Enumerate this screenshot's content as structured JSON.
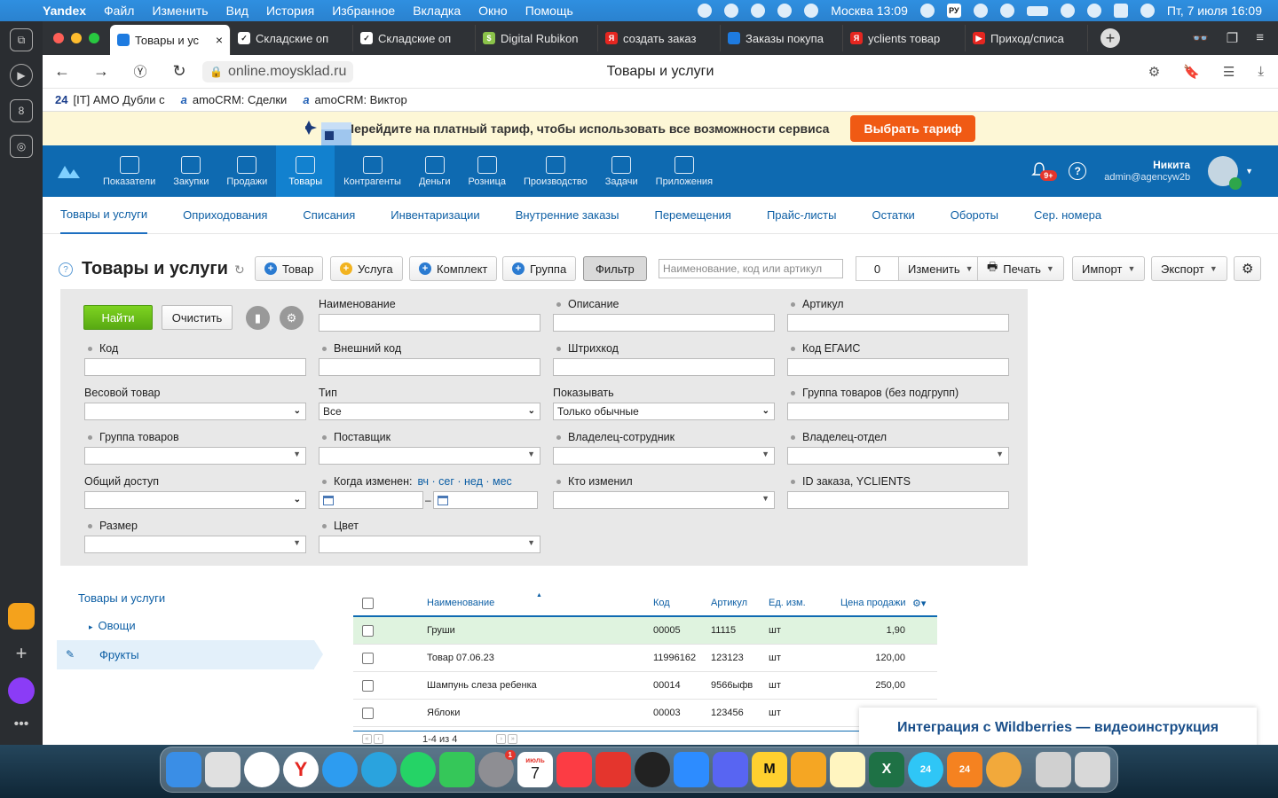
{
  "menubar": {
    "app": "Yandex",
    "items": [
      "Файл",
      "Изменить",
      "Вид",
      "История",
      "Избранное",
      "Вкладка",
      "Окно",
      "Помощь"
    ],
    "city_time": "Москва 13:09",
    "lang": "РУ",
    "datetime": "Пт, 7 июля  16:09"
  },
  "browser": {
    "tabs": [
      {
        "title": "Товары и ус",
        "fav_color": "#1e7be0",
        "fav_glyph": "◆"
      },
      {
        "title": "Складские оп",
        "fav_color": "#ffffff",
        "fav_glyph": "✓"
      },
      {
        "title": "Складские оп",
        "fav_color": "#ffffff",
        "fav_glyph": "✓"
      },
      {
        "title": "Digital Rubikon",
        "fav_color": "#8bc34a",
        "fav_glyph": "$"
      },
      {
        "title": "создать заказ",
        "fav_color": "#e52620",
        "fav_glyph": "Я"
      },
      {
        "title": "Заказы покупа",
        "fav_color": "#1e7be0",
        "fav_glyph": "◆"
      },
      {
        "title": "yclients товар",
        "fav_color": "#e52620",
        "fav_glyph": "Я"
      },
      {
        "title": "Приход/списа",
        "fav_color": "#e52620",
        "fav_glyph": "▶"
      }
    ],
    "url": "online.moysklad.ru",
    "page_title": "Товары и услуги",
    "bookmarks": [
      {
        "prefix": "24",
        "label": "[IT] АМО Дубли с"
      },
      {
        "prefix": "a",
        "label": "amoCRM: Сделки"
      },
      {
        "prefix": "a",
        "label": "amoCRM: Виктор"
      }
    ]
  },
  "promo": {
    "text": "Перейдите на платный тариф, чтобы использовать все возможности сервиса",
    "button": "Выбрать тариф"
  },
  "topnav": {
    "items": [
      "Показатели",
      "Закупки",
      "Продажи",
      "Товары",
      "Контрагенты",
      "Деньги",
      "Розница",
      "Производство",
      "Задачи",
      "Приложения"
    ],
    "active": "Товары",
    "notifications": "9+",
    "user_name": "Никита",
    "user_email": "admin@agencyw2b"
  },
  "subnav": [
    "Товары и услуги",
    "Оприходования",
    "Списания",
    "Инвентаризации",
    "Внутренние заказы",
    "Перемещения",
    "Прайс-листы",
    "Остатки",
    "Обороты",
    "Сер. номера"
  ],
  "toolbar": {
    "title": "Товары и услуги",
    "btn_product": "Товар",
    "btn_service": "Услуга",
    "btn_kit": "Комплект",
    "btn_group": "Группа",
    "btn_filter": "Фильтр",
    "search_placeholder": "Наименование, код или артикул",
    "count": "0",
    "btn_change": "Изменить",
    "btn_print": "Печать",
    "btn_import": "Импорт",
    "btn_export": "Экспорт"
  },
  "filter": {
    "find": "Найти",
    "clear": "Очистить",
    "fields": {
      "name": "Наименование",
      "description": "Описание",
      "article": "Артикул",
      "code": "Код",
      "external_code": "Внешний код",
      "barcode": "Штрихкод",
      "egais": "Код ЕГАИС",
      "weight": "Весовой товар",
      "type": "Тип",
      "type_value": "Все",
      "show": "Показывать",
      "show_value": "Только обычные",
      "group_nosub": "Группа товаров (без подгрупп)",
      "group": "Группа товаров",
      "supplier": "Поставщик",
      "owner_employee": "Владелец-сотрудник",
      "owner_dept": "Владелец-отдел",
      "shared": "Общий доступ",
      "changed": "Когда изменен:",
      "changed_links": "вч · сег · нед · мес",
      "who_changed": "Кто изменил",
      "yclients": "ID заказа, YCLIENTS",
      "size": "Размер",
      "color": "Цвет"
    }
  },
  "tree": {
    "root": "Товары и услуги",
    "nodes": [
      "Овощи",
      "Фрукты"
    ]
  },
  "table": {
    "headers": {
      "name": "Наименование",
      "code": "Код",
      "article": "Артикул",
      "unit": "Ед. изм.",
      "price": "Цена продажи"
    },
    "rows": [
      {
        "name": "Груши",
        "code": "00005",
        "article": "11115",
        "unit": "шт",
        "price": "1,90"
      },
      {
        "name": "Товар 07.06.23",
        "code": "11996162",
        "article": "123123",
        "unit": "шт",
        "price": "120,00"
      },
      {
        "name": "Шампунь слеза ребенка",
        "code": "00014",
        "article": "9566ыфв",
        "unit": "шт",
        "price": "250,00"
      },
      {
        "name": "Яблоки",
        "code": "00003",
        "article": "123456",
        "unit": "шт",
        "price": ""
      }
    ],
    "pager": "1-4 из 4"
  },
  "popup": "Интеграция с Wildberries — видеоинструкция",
  "dock": {
    "calendar_month": "июль",
    "calendar_day": "7",
    "settings_badge": "1"
  }
}
